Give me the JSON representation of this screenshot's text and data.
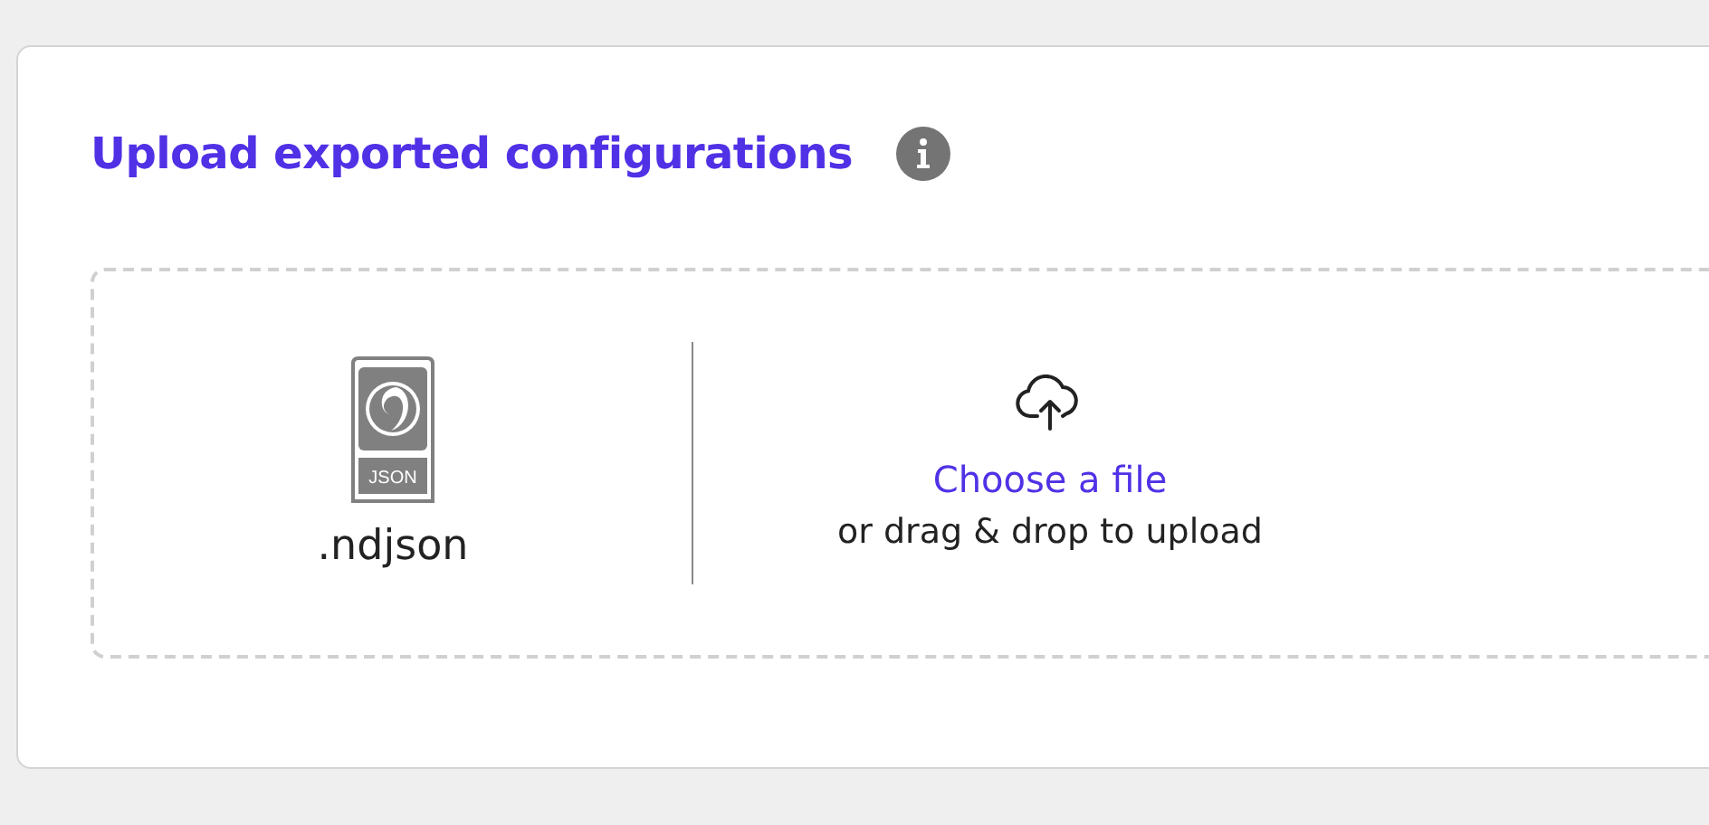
{
  "card": {
    "title": "Upload exported configurations"
  },
  "dropzone": {
    "file_type": {
      "icon_label": "JSON",
      "extension": ".ndjson"
    },
    "link": "Choose a file",
    "hint": "or drag & drop to upload"
  }
}
